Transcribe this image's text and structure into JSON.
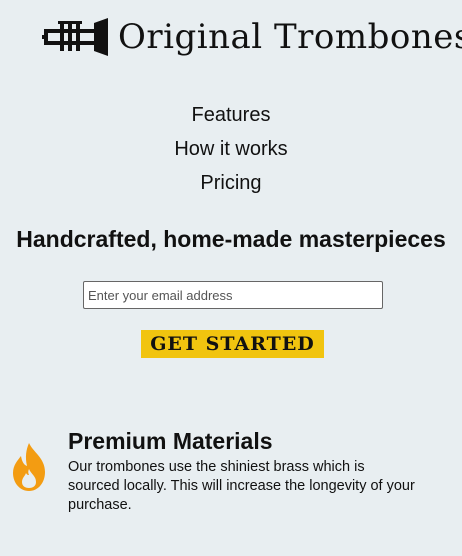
{
  "brand": {
    "name": "Original Trombones",
    "logo_icon": "trombone-logo-icon"
  },
  "nav": {
    "items": [
      {
        "label": "Features"
      },
      {
        "label": "How it works"
      },
      {
        "label": "Pricing"
      }
    ]
  },
  "hero": {
    "title": "Handcrafted, home-made masterpieces",
    "email_placeholder": "Enter your email address",
    "cta_label": "GET STARTED"
  },
  "features": [
    {
      "icon": "fire-icon",
      "title": "Premium Materials",
      "text": "Our trombones use the shiniest brass which is sourced locally. This will increase the longevity of your purchase."
    }
  ],
  "colors": {
    "background": "#e8eef1",
    "accent": "#f1c40f",
    "icon": "#f39c12"
  }
}
